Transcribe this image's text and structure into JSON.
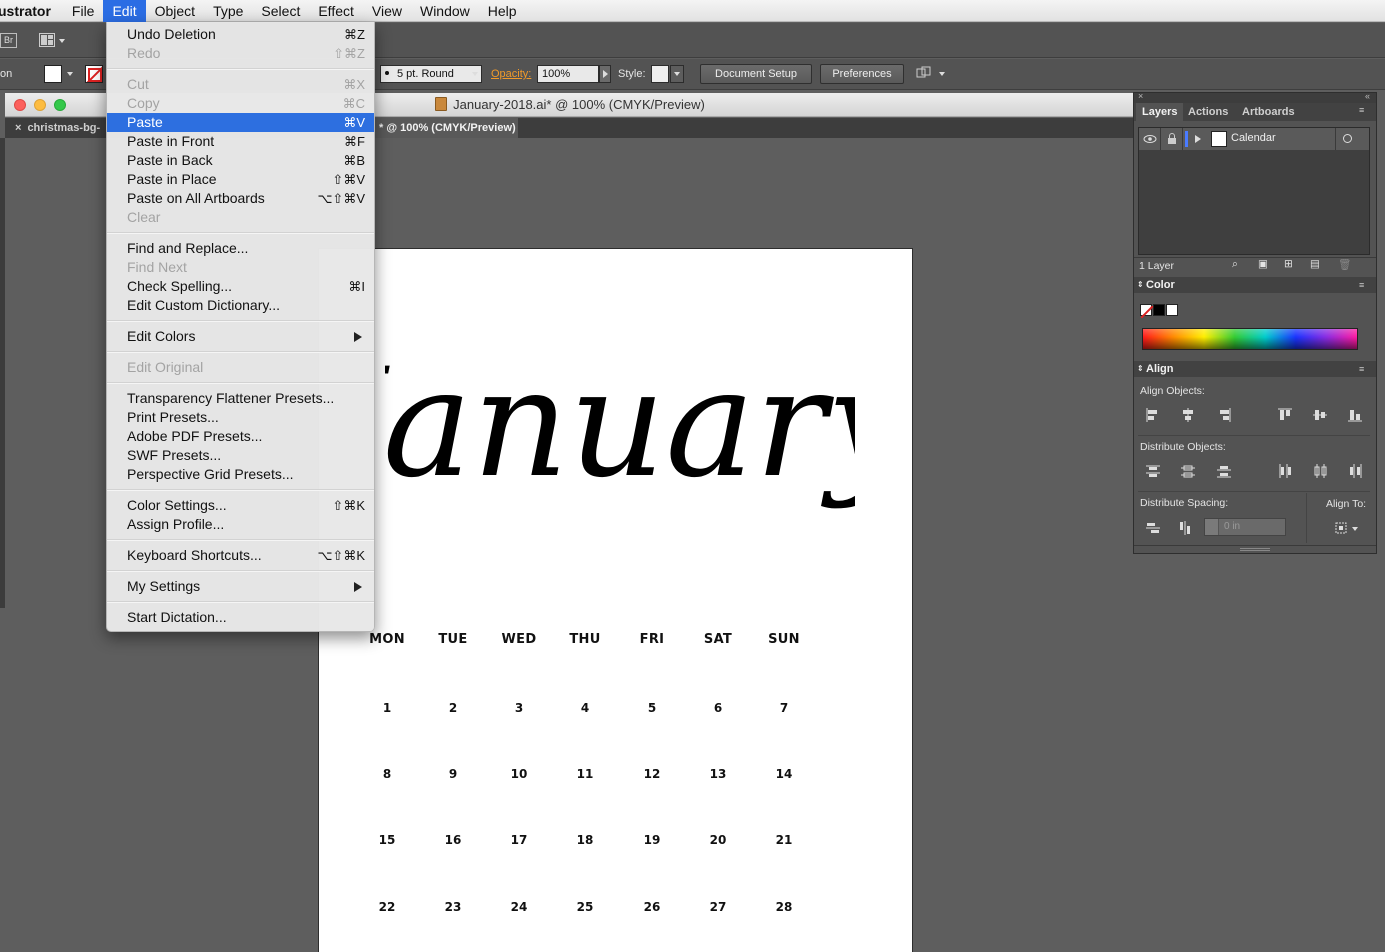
{
  "menubar": {
    "app_name": "ustrator",
    "items": [
      "File",
      "Edit",
      "Object",
      "Type",
      "Select",
      "Effect",
      "View",
      "Window",
      "Help"
    ],
    "active": "Edit"
  },
  "control_bar": {
    "left_fragment": "on",
    "stroke_profile": "5 pt. Round",
    "opacity_label": "Opacity:",
    "opacity_value": "100%",
    "style_label": "Style:",
    "document_setup_label": "Document Setup",
    "preferences_label": "Preferences",
    "bridge_label": "Br"
  },
  "document": {
    "title": "January-2018.ai* @ 100% (CMYK/Preview)",
    "tabs": [
      {
        "label": "christmas-bg-",
        "active": false
      },
      {
        "label": "* @ 100% (CMYK/Preview)",
        "active": true
      }
    ],
    "close_glyph": "×"
  },
  "artboard": {
    "heading": "January",
    "weekdays": [
      "MON",
      "TUE",
      "WED",
      "THU",
      "FRI",
      "SAT",
      "SUN"
    ],
    "weeks": [
      [
        "1",
        "2",
        "3",
        "4",
        "5",
        "6",
        "7"
      ],
      [
        "8",
        "9",
        "10",
        "11",
        "12",
        "13",
        "14"
      ],
      [
        "15",
        "16",
        "17",
        "18",
        "19",
        "20",
        "21"
      ],
      [
        "22",
        "23",
        "24",
        "25",
        "26",
        "27",
        "28"
      ]
    ]
  },
  "edit_menu": {
    "groups": [
      [
        {
          "label": "Undo Deletion",
          "shortcut": "⌘Z",
          "enabled": true
        },
        {
          "label": "Redo",
          "shortcut": "⇧⌘Z",
          "enabled": false
        }
      ],
      [
        {
          "label": "Cut",
          "shortcut": "⌘X",
          "enabled": false
        },
        {
          "label": "Copy",
          "shortcut": "⌘C",
          "enabled": false
        },
        {
          "label": "Paste",
          "shortcut": "⌘V",
          "enabled": true,
          "highlighted": true
        },
        {
          "label": "Paste in Front",
          "shortcut": "⌘F",
          "enabled": true
        },
        {
          "label": "Paste in Back",
          "shortcut": "⌘B",
          "enabled": true
        },
        {
          "label": "Paste in Place",
          "shortcut": "⇧⌘V",
          "enabled": true
        },
        {
          "label": "Paste on All Artboards",
          "shortcut": "⌥⇧⌘V",
          "enabled": true
        },
        {
          "label": "Clear",
          "shortcut": "",
          "enabled": false
        }
      ],
      [
        {
          "label": "Find and Replace...",
          "shortcut": "",
          "enabled": true
        },
        {
          "label": "Find Next",
          "shortcut": "",
          "enabled": false
        },
        {
          "label": "Check Spelling...",
          "shortcut": "⌘I",
          "enabled": true
        },
        {
          "label": "Edit Custom Dictionary...",
          "shortcut": "",
          "enabled": true
        }
      ],
      [
        {
          "label": "Edit Colors",
          "shortcut": "",
          "enabled": true,
          "submenu": true
        }
      ],
      [
        {
          "label": "Edit Original",
          "shortcut": "",
          "enabled": false
        }
      ],
      [
        {
          "label": "Transparency Flattener Presets...",
          "shortcut": "",
          "enabled": true
        },
        {
          "label": "Print Presets...",
          "shortcut": "",
          "enabled": true
        },
        {
          "label": "Adobe PDF Presets...",
          "shortcut": "",
          "enabled": true
        },
        {
          "label": "SWF Presets...",
          "shortcut": "",
          "enabled": true
        },
        {
          "label": "Perspective Grid Presets...",
          "shortcut": "",
          "enabled": true
        }
      ],
      [
        {
          "label": "Color Settings...",
          "shortcut": "⇧⌘K",
          "enabled": true
        },
        {
          "label": "Assign Profile...",
          "shortcut": "",
          "enabled": true
        }
      ],
      [
        {
          "label": "Keyboard Shortcuts...",
          "shortcut": "⌥⇧⌘K",
          "enabled": true
        }
      ],
      [
        {
          "label": "My Settings",
          "shortcut": "",
          "enabled": true,
          "submenu": true
        }
      ],
      [
        {
          "label": "Start Dictation...",
          "shortcut": "",
          "enabled": true
        }
      ]
    ]
  },
  "panels": {
    "tabs": [
      {
        "label": "Layers",
        "active": true
      },
      {
        "label": "Actions",
        "active": false
      },
      {
        "label": "Artboards",
        "active": false
      }
    ],
    "layer_name": "Calendar",
    "layer_count": "1 Layer",
    "color_title": "Color",
    "align_title": "Align",
    "align_objects_label": "Align Objects:",
    "distribute_objects_label": "Distribute Objects:",
    "distribute_spacing_label": "Distribute Spacing:",
    "align_to_label": "Align To:",
    "spacing_value": "0 in"
  },
  "colors": {
    "menu_highlight": "#2d6fe0",
    "panel_bg": "#535353",
    "canvas_bg": "#5e5e5e",
    "opacity_label": "#f09a2a"
  }
}
